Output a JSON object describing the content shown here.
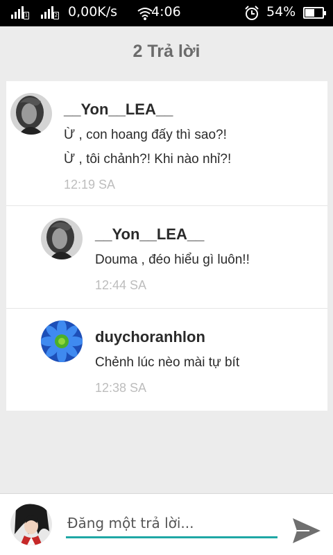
{
  "status_bar": {
    "network_speed": "0,00K/s",
    "time": "4:06",
    "battery": "54%",
    "battery_level": 0.54,
    "sim1_label": "1",
    "sim2_label": "2"
  },
  "header": {
    "title": "2 Trả lời"
  },
  "comments": [
    {
      "author": "__Yon__LEA__",
      "lines": [
        "Ừ , con hoang đấy thì sao?!",
        "Ừ , tôi chảnh?! Khi nào nhỉ?!"
      ],
      "time": "12:19 SA",
      "avatar": "girl-photo"
    },
    {
      "author": "__Yon__LEA__",
      "lines": [
        "Douma , đéo hiểu gì luôn!!"
      ],
      "time": "12:44 SA",
      "avatar": "girl-photo"
    },
    {
      "author": "duychoranhlon",
      "lines": [
        "Chẻnh lúc nèo mài tự bít"
      ],
      "time": "12:38 SA",
      "avatar": "blue-flower-photo"
    }
  ],
  "composer": {
    "placeholder": "Đăng một trả lời...",
    "send_icon": "send-icon",
    "accent_color": "#1fa7a5"
  }
}
